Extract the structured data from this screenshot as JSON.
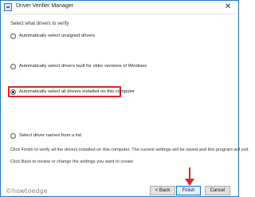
{
  "window": {
    "title": "Driver Verifier Manager",
    "close_glyph": "✕"
  },
  "main": {
    "group_label": "Select what drivers to verify",
    "options": [
      {
        "label": "Automatically select unsigned drivers",
        "checked": false
      },
      {
        "label": "Automatically select drivers built for older versions of Windows",
        "checked": false
      },
      {
        "label": "Automatically select all drivers installed on this computer",
        "checked": true
      },
      {
        "label": "Select driver names from a list",
        "checked": false
      }
    ],
    "info_line_1": "Click Finish to verify all the drivers installed on this computer. The current settings will be saved and this program will exit.",
    "info_line_2": "Click Back to review or change the settings you want to create."
  },
  "footer": {
    "back_label": "< Back",
    "finish_label": "Finish",
    "cancel_label": "Cancel"
  },
  "watermark": "©howtoedge",
  "colors": {
    "highlight": "#d9262c",
    "arrow": "#d9262c",
    "accent": "#0078d7"
  }
}
